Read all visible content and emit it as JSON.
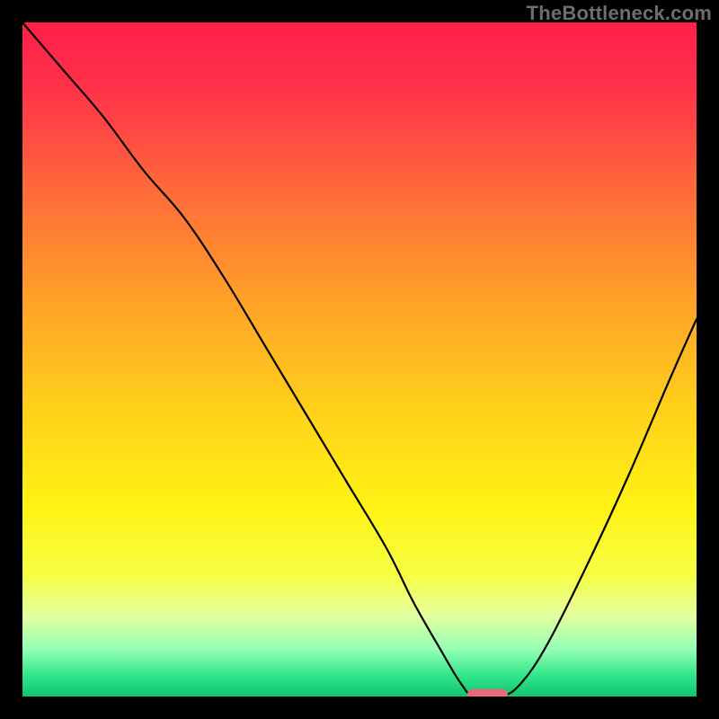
{
  "watermark": "TheBottleneck.com",
  "colors": {
    "black": "#000000",
    "curve": "#000000",
    "marker": "#e66a7a",
    "gradient_stops": [
      {
        "offset": 0.0,
        "color": "#ff1f4a"
      },
      {
        "offset": 0.1,
        "color": "#ff3249"
      },
      {
        "offset": 0.25,
        "color": "#ff6a3a"
      },
      {
        "offset": 0.42,
        "color": "#ffa427"
      },
      {
        "offset": 0.58,
        "color": "#ffd21a"
      },
      {
        "offset": 0.72,
        "color": "#fff314"
      },
      {
        "offset": 0.82,
        "color": "#f6ff44"
      },
      {
        "offset": 0.88,
        "color": "#e4ffa0"
      },
      {
        "offset": 0.93,
        "color": "#94ffb4"
      },
      {
        "offset": 0.97,
        "color": "#2fe58a"
      },
      {
        "offset": 1.0,
        "color": "#11c46f"
      }
    ]
  },
  "chart_data": {
    "type": "line",
    "title": "",
    "xlabel": "",
    "ylabel": "",
    "xlim": [
      0,
      100
    ],
    "ylim": [
      0,
      100
    ],
    "legend": false,
    "grid": false,
    "annotations": [],
    "series": [
      {
        "name": "bottleneck-curve",
        "x": [
          0,
          6,
          12,
          18,
          24,
          30,
          36,
          42,
          48,
          54,
          58,
          62,
          65,
          67,
          71,
          74,
          78,
          84,
          90,
          96,
          100
        ],
        "y": [
          100,
          93,
          86,
          78,
          71,
          62,
          52,
          42,
          32,
          22,
          14,
          7,
          2,
          0,
          0,
          2,
          8,
          20,
          33,
          47,
          56
        ]
      }
    ],
    "marker": {
      "name": "optimal-range",
      "x_start": 66,
      "x_end": 72,
      "y": 0.3,
      "color": "#e66a7a"
    }
  }
}
